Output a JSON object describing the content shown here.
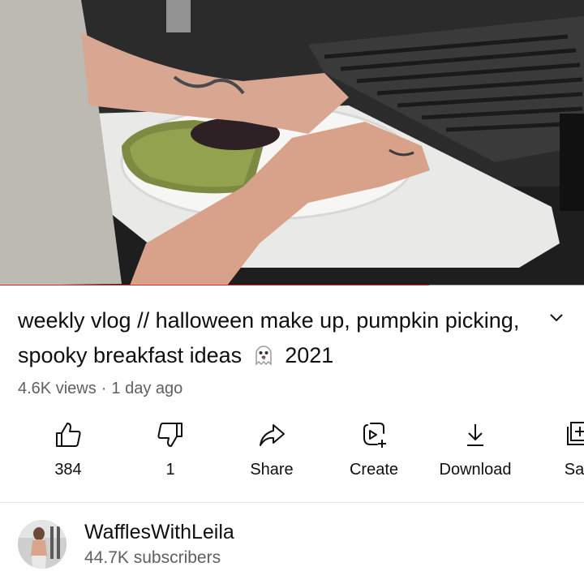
{
  "video": {
    "progress_fraction": 0.735
  },
  "title": {
    "text_part1": "weekly vlog // halloween make up, pumpkin picking, spooky breakfast ideas",
    "emoji_icon": "ghost-emoji",
    "text_part2": "2021",
    "expand_icon": "chevron-down-icon"
  },
  "meta": {
    "views": "4.6K views",
    "separator": "·",
    "age": "1 day ago"
  },
  "actions": [
    {
      "name": "like-button",
      "icon": "thumbs-up-icon",
      "label": "384"
    },
    {
      "name": "dislike-button",
      "icon": "thumbs-down-icon",
      "label": "1"
    },
    {
      "name": "share-button",
      "icon": "share-arrow-icon",
      "label": "Share"
    },
    {
      "name": "create-button",
      "icon": "create-remix-icon",
      "label": "Create"
    },
    {
      "name": "download-button",
      "icon": "download-icon",
      "label": "Download"
    },
    {
      "name": "save-button",
      "icon": "playlist-add-icon",
      "label": "Sav"
    }
  ],
  "channel": {
    "name": "WafflesWithLeila",
    "subscribers": "44.7K subscribers"
  },
  "colors": {
    "progress": "#e8252b",
    "secondary_text": "#606060"
  }
}
